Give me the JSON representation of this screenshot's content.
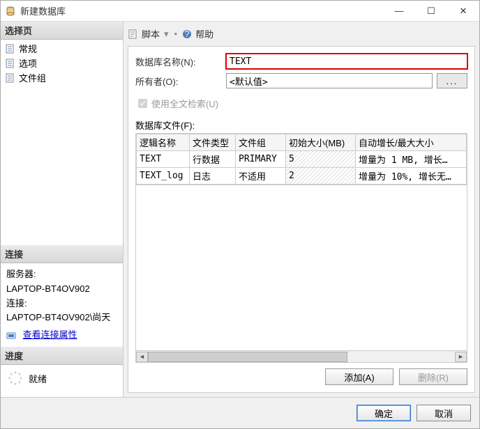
{
  "window": {
    "title": "新建数据库"
  },
  "winbtns": {
    "min": "—",
    "max": "☐",
    "close": "✕"
  },
  "left": {
    "select_header": "选择页",
    "items": [
      "常规",
      "选项",
      "文件组"
    ],
    "conn_header": "连接",
    "server_label": "服务器:",
    "server_value": "LAPTOP-BT4OV902",
    "conn_label": "连接:",
    "conn_value": "LAPTOP-BT4OV902\\尚天",
    "view_conn": "查看连接属性",
    "progress_header": "进度",
    "progress_status": "就绪"
  },
  "toolbar": {
    "script": "脚本",
    "sep": "▾",
    "help": "帮助"
  },
  "form": {
    "name_label": "数据库名称(N):",
    "name_value": "TEXT",
    "owner_label": "所有者(O):",
    "owner_value": "<默认值>",
    "fulltext_label": "使用全文检索(U)",
    "files_label": "数据库文件(F):"
  },
  "table": {
    "headers": [
      "逻辑名称",
      "文件类型",
      "文件组",
      "初始大小(MB)",
      "自动增长/最大大小"
    ],
    "rows": [
      {
        "name": "TEXT",
        "type": "行数据",
        "group": "PRIMARY",
        "size": "5",
        "growth": "增量为 1 MB, 增长…"
      },
      {
        "name": "TEXT_log",
        "type": "日志",
        "group": "不适用",
        "size": "2",
        "growth": "增量为 10%, 增长无…"
      }
    ]
  },
  "buttons": {
    "add": "添加(A)",
    "remove": "删除(R)",
    "ok": "确定",
    "cancel": "取消"
  }
}
